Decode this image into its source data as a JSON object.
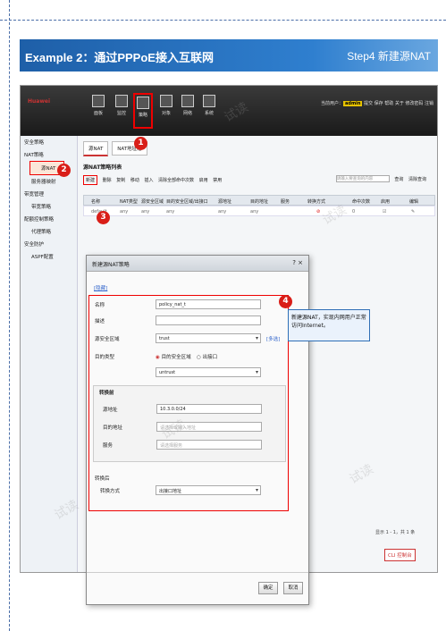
{
  "banner": {
    "title": "Example 2：通过PPPoE接入互联网",
    "step": "Step4 新建源NAT"
  },
  "topbar": {
    "logo": "Huawei",
    "nav": [
      "面板",
      "监控",
      "策略",
      "对象",
      "网络",
      "系统"
    ],
    "user": "当前用户：",
    "user_name": "admin",
    "links": "提交 保存 帮助 关于 修改密码 注销"
  },
  "sidebar": {
    "items": [
      "安全策略",
      "NAT策略",
      "源NAT",
      "服务器映射",
      "带宽管理",
      "带宽策略",
      "配额控制策略",
      "代理策略",
      "安全防护",
      "ASPF配置"
    ]
  },
  "tabs": [
    "源NAT",
    "NAT地址池"
  ],
  "list_title": "源NAT策略列表",
  "toolbar": {
    "new": "新建",
    "delete": "删除",
    "copy": "复制",
    "move": "移动",
    "insert": "插入",
    "clear": "清除全部命中次数",
    "enable": "启用",
    "disable": "禁用",
    "search_label": "请输入要查询的内容",
    "query": "查询",
    "clear_query": "清除查询"
  },
  "table": {
    "headers": [
      "名称",
      "NAT类型",
      "源安全区域",
      "目的安全区域/出接口",
      "源地址",
      "目的地址",
      "服务",
      "转换方式",
      "命中次数",
      "启用",
      "编辑"
    ],
    "row": [
      "default",
      "any",
      "any",
      "any",
      "any",
      "any",
      "",
      "",
      "0",
      "",
      ""
    ]
  },
  "dialog": {
    "title": "新建源NAT策略",
    "controls": "? ×",
    "advanced": "[隐藏]",
    "fields": {
      "name_label": "名称",
      "name_value": "policy_nat_t",
      "desc_label": "描述",
      "src_zone_label": "源安全区域",
      "src_zone_value": "trust",
      "multi": "[多选]",
      "dst_type_label": "目的类型",
      "dst_opt1": "目的安全区域",
      "dst_opt2": "出接口",
      "dst_zone_value": "untrust",
      "group_title": "转换前",
      "src_addr_label": "源地址",
      "src_addr_value": "10.3.0.0/24",
      "dst_addr_label": "目的地址",
      "dst_addr_ph": "请选择或输入地址",
      "service_label": "服务",
      "service_ph": "请选择服务",
      "after_title": "转换后",
      "mode_label": "转换方式",
      "mode_value": "出接口地址"
    },
    "ok": "确定",
    "cancel": "取消"
  },
  "callout": "新建源NAT，实现内网用户正常访问Internet。",
  "pager": "显示 1 - 1，共 1 条",
  "cli": "CLI 控制台",
  "badges": [
    "1",
    "2",
    "3",
    "4"
  ],
  "watermark": "试读",
  "colors": {
    "banner": "#2f7fcf",
    "highlight": "#e00000",
    "badge": "#d91e18"
  }
}
